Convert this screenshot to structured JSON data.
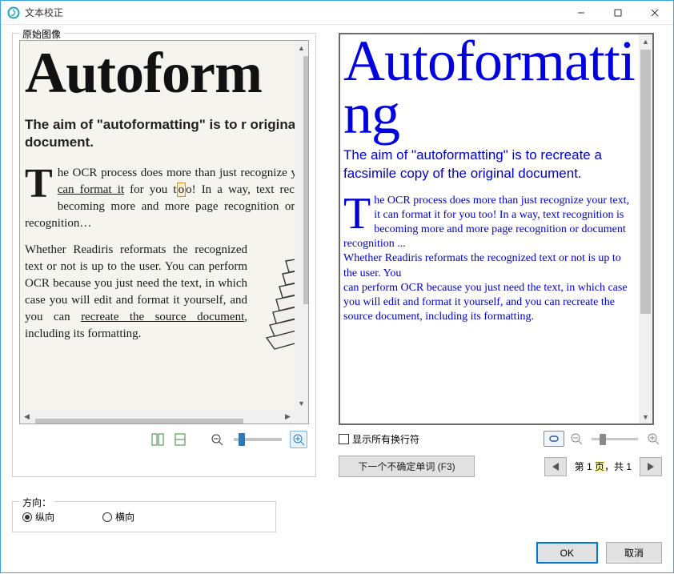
{
  "window": {
    "title": "文本校正"
  },
  "left": {
    "groupTitle": "原始图像",
    "scanHeading": "Autoform",
    "scanSub": "The aim of \"autoformatting\" is to r original document.",
    "scanPara1_pre": "he OCR process does more than just recognize your text, ",
    "scanPara1_u1": "it can format it",
    "scanPara1_mid": " for you t",
    "scanPara1_hl": "o",
    "scanPara1_post": "o! In a way, text recognition is becoming more and more page recognition or document recognition…",
    "scanPara2_pre": "Whether Readiris reformats the recognized text or not is up to the user. You can perform OCR because you just need the text, in which case you will edit and format it yourself, and you can ",
    "scanPara2_u": "recreate the source document",
    "scanPara2_post": ", including its formatting."
  },
  "right": {
    "ocrHeading": "Autoformatting",
    "ocrSub": "The aim of \"autoformatting\" is to recreate a facsimile copy of the original document.",
    "ocrPara1": "he OCR process does more than just recognize your text, it can format it for you too! In a way, text recognition is becoming more and more page recognition or document recognition ...",
    "ocrPara2": "Whether Readiris reformats the recognized text or not is up to the user. You",
    "ocrPara3": "can perform OCR because you just need the text, in which case you will edit and format it yourself, and you can recreate the source document, including its formatting.",
    "showLineBreaks": "显示所有换行符",
    "nextWordBtn": "下一个不确定单词 (F3)",
    "pagePrefix": "第 1 ",
    "pageHighlight": "页",
    "pageSuffix": "，共 1"
  },
  "direction": {
    "groupTitle": "方向：",
    "portrait": "纵向",
    "landscape": "横向"
  },
  "footer": {
    "ok": "OK",
    "cancel": "取消"
  }
}
